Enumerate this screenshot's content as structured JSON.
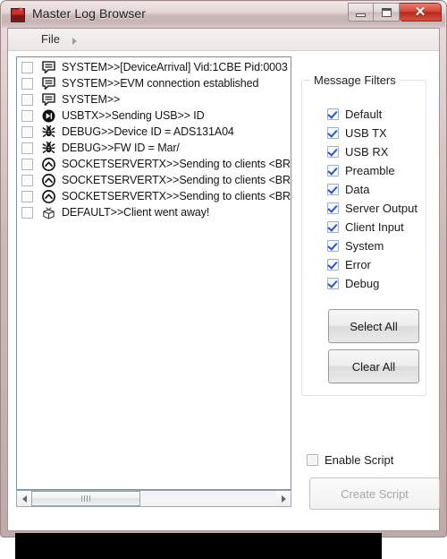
{
  "window": {
    "title": "Master Log Browser",
    "icon": "app-icon",
    "controls": {
      "minimize": "minimize-button",
      "maximize": "maximize-button",
      "close_glyph": "✕"
    }
  },
  "menubar": {
    "items": [
      {
        "label": "File"
      }
    ],
    "overflow_icon": "chevron-right-icon"
  },
  "log": {
    "entries": [
      {
        "icon": "message-bubble-icon",
        "text": "SYSTEM>>[DeviceArrival] Vid:1CBE Pid:0003",
        "checked": false
      },
      {
        "icon": "message-bubble-icon",
        "text": "SYSTEM>>EVM connection established",
        "checked": false
      },
      {
        "icon": "message-bubble-icon",
        "text": "SYSTEM>>",
        "checked": false
      },
      {
        "icon": "play-next-icon",
        "text": "USBTX>>Sending USB>> ID",
        "checked": false
      },
      {
        "icon": "bug-icon",
        "text": "DEBUG>>Device ID = ADS131A04",
        "checked": false
      },
      {
        "icon": "bug-icon",
        "text": "DEBUG>>FW ID = Mar/",
        "checked": false
      },
      {
        "icon": "circle-up-chevron-icon",
        "text": "SOCKETSERVERTX>>Sending to clients <BROA",
        "checked": false
      },
      {
        "icon": "circle-up-chevron-icon",
        "text": "SOCKETSERVERTX>>Sending to clients <BROA",
        "checked": false
      },
      {
        "icon": "circle-up-chevron-icon",
        "text": "SOCKETSERVERTX>>Sending to clients <BROA",
        "checked": false
      },
      {
        "icon": "package-box-icon",
        "text": "DEFAULT>>Client went away!",
        "checked": false
      }
    ],
    "scrollbar": {
      "left_arrow_icon": "triangle-left-icon",
      "right_arrow_icon": "triangle-right-icon"
    }
  },
  "filters": {
    "group_title": "Message Filters",
    "items": [
      {
        "label": "Default",
        "checked": true
      },
      {
        "label": "USB TX",
        "checked": true
      },
      {
        "label": "USB RX",
        "checked": true
      },
      {
        "label": "Preamble",
        "checked": true
      },
      {
        "label": "Data",
        "checked": true
      },
      {
        "label": "Server Output",
        "checked": true
      },
      {
        "label": "Client Input",
        "checked": true
      },
      {
        "label": "System",
        "checked": true
      },
      {
        "label": "Error",
        "checked": true
      },
      {
        "label": "Debug",
        "checked": true
      }
    ],
    "select_all_label": "Select All",
    "clear_all_label": "Clear All"
  },
  "script": {
    "enable_label": "Enable Script",
    "enable_checked": false,
    "create_label": "Create Script",
    "create_enabled": false
  },
  "colors": {
    "frame": "#bfaaaa",
    "titlebar": "#d8c9c9",
    "close_button": "#c6301f",
    "checkbox_check": "#2a4fd8",
    "list_border": "#7a8ca0",
    "console_background": "#000000"
  }
}
